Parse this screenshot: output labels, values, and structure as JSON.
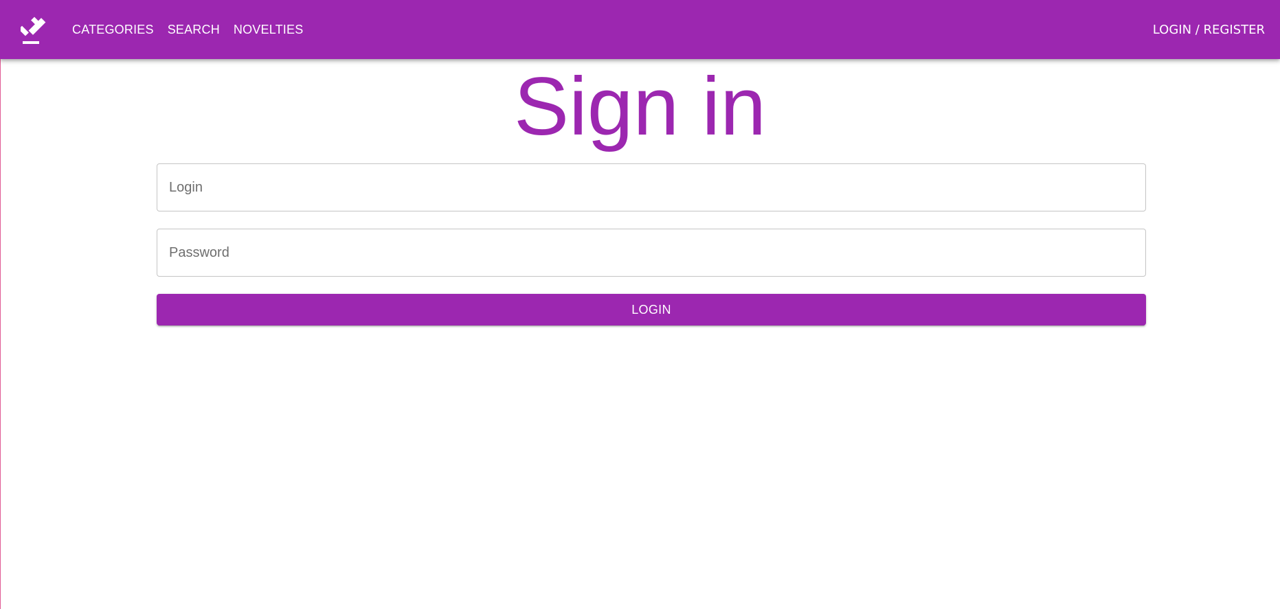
{
  "header": {
    "logo_icon": "gavel-icon",
    "nav": [
      {
        "label": "CATEGORIES"
      },
      {
        "label": "SEARCH"
      },
      {
        "label": "NOVELTIES"
      }
    ],
    "auth_label": "LOGIN / REGISTER"
  },
  "main": {
    "title": "Sign in",
    "login_placeholder": "Login",
    "login_value": "",
    "password_placeholder": "Password",
    "password_value": "",
    "submit_label": "LOGIN"
  },
  "colors": {
    "accent": "#9c27b0",
    "background": "#ffffff"
  }
}
